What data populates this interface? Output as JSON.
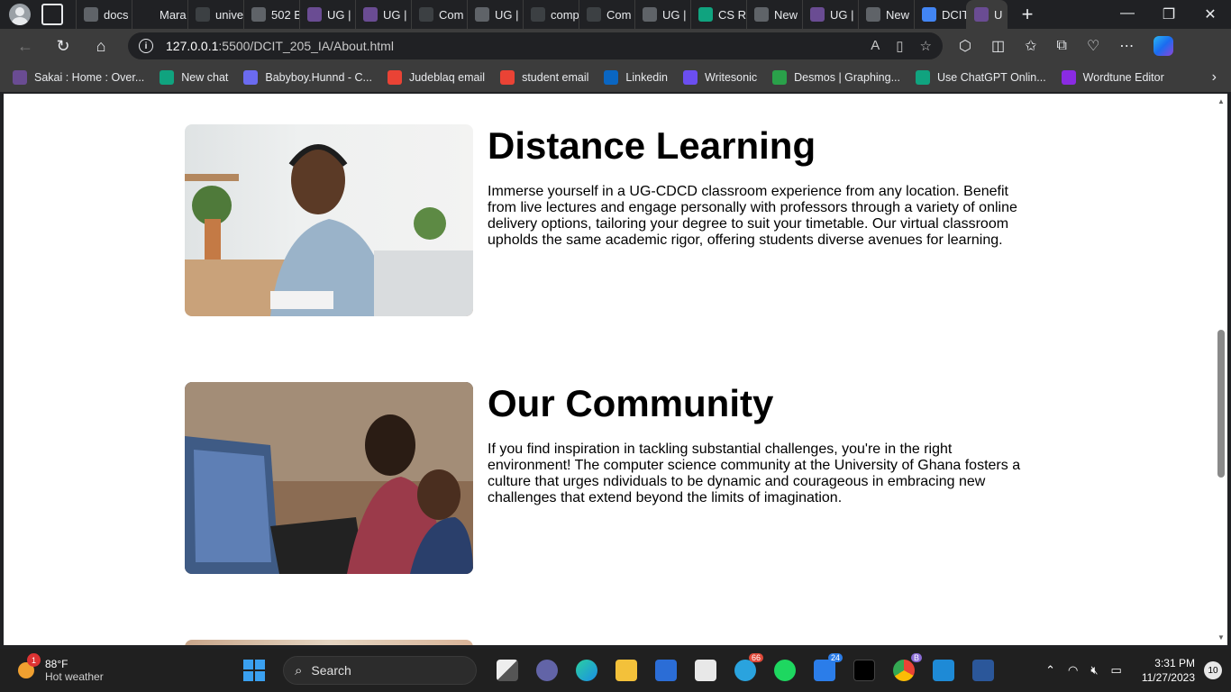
{
  "tabs": [
    {
      "label": "docs",
      "color": "#5f6368"
    },
    {
      "label": "Mara",
      "color": "#202124",
      "icon": "github-icon"
    },
    {
      "label": "unive",
      "color": "#3c4043"
    },
    {
      "label": "502 B",
      "color": "#5f6368"
    },
    {
      "label": "UG |",
      "color": "#6a4c93"
    },
    {
      "label": "UG |",
      "color": "#6a4c93"
    },
    {
      "label": "Com",
      "color": "#3c4043"
    },
    {
      "label": "UG |",
      "color": "#5f6368"
    },
    {
      "label": "comp",
      "color": "#3c4043"
    },
    {
      "label": "Com",
      "color": "#3c4043"
    },
    {
      "label": "UG |",
      "color": "#5f6368"
    },
    {
      "label": "CS R",
      "color": "#10a37f"
    },
    {
      "label": "New",
      "color": "#5f6368"
    },
    {
      "label": "UG |",
      "color": "#6a4c93"
    },
    {
      "label": "New",
      "color": "#5f6368"
    },
    {
      "label": "DCIT",
      "color": "#4285f4"
    },
    {
      "label": "U",
      "color": "#6a4c93",
      "active": true
    }
  ],
  "address": {
    "host": "127.0.0.1",
    "path": ":5500/DCIT_205_IA/About.html"
  },
  "bookmarks": [
    {
      "label": "Sakai : Home : Over...",
      "color": "#6a4c93"
    },
    {
      "label": "New chat",
      "color": "#10a37f"
    },
    {
      "label": "Babyboy.Hunnd - C...",
      "color": "#6b6bf0"
    },
    {
      "label": "Judeblaq email",
      "color": "#ea4335"
    },
    {
      "label": "student email",
      "color": "#ea4335"
    },
    {
      "label": "Linkedin",
      "color": "#0a66c2"
    },
    {
      "label": "Writesonic",
      "color": "#6b4ef0"
    },
    {
      "label": "Desmos | Graphing...",
      "color": "#2aa14a"
    },
    {
      "label": "Use ChatGPT Onlin...",
      "color": "#10a37f"
    },
    {
      "label": "Wordtune Editor",
      "color": "#8a2be2"
    }
  ],
  "sections": [
    {
      "title": "Distance Learning",
      "body": "Immerse yourself in a UG-CDCD classroom experience from any location. Benefit from live lectures and engage personally with professors through a variety of online delivery options, tailoring your degree to suit your timetable. Our virtual classroom upholds the same academic rigor, offering students diverse avenues for learning."
    },
    {
      "title": "Our Community",
      "body": "If you find inspiration in tackling substantial challenges, you're in the right environment! The computer science community at the University of Ghana fosters a culture that urges ndividuals to be dynamic and courageous in embracing new challenges that extend beyond the limits of imagination."
    }
  ],
  "taskbar": {
    "weather_temp": "88°F",
    "weather_desc": "Hot weather",
    "weather_badge": "1",
    "search_placeholder": "Search",
    "telegram_count": "66",
    "mail_count": "24",
    "chrome_badge": "B",
    "time": "3:31 PM",
    "date": "11/27/2023",
    "notifications": "10"
  }
}
